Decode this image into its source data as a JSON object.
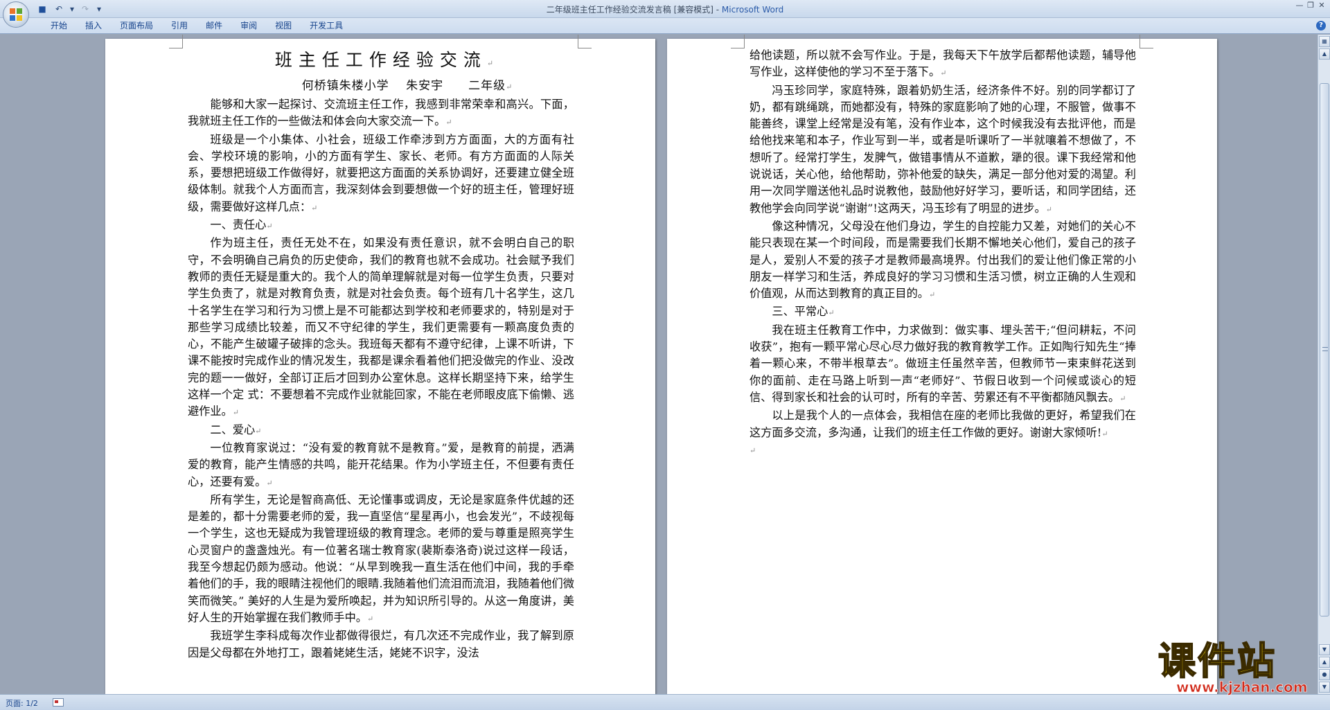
{
  "window": {
    "title": "二年级班主任工作经验交流发言稿 [兼容模式] - ",
    "app_name": "Microsoft Word"
  },
  "ribbon": {
    "tabs": [
      "开始",
      "插入",
      "页面布局",
      "引用",
      "邮件",
      "审阅",
      "视图",
      "开发工具"
    ]
  },
  "status": {
    "page": "页面: 1/2"
  },
  "watermark": {
    "text": "课件站",
    "url": "www.kjzhan.com"
  },
  "page1": {
    "title": "班主任工作经验交流",
    "subtitle": "何桥镇朱楼小学　 朱安宇　　二年级",
    "paragraphs": [
      "能够和大家一起探讨、交流班主任工作，我感到非常荣幸和高兴。下面，我就班主任工作的一些做法和体会向大家交流一下。",
      "班级是一个小集体、小社会，班级工作牵涉到方方面面，大的方面有社会、学校环境的影响，小的方面有学生、家长、老师。有方方面面的人际关系，要想把班级工作做得好，就要把这方面面的关系协调好，还要建立健全班级体制。就我个人方面而言，我深刻体会到要想做一个好的班主任，管理好班级，需要做好这样几点：",
      "一、责任心",
      "作为班主任，责任无处不在，如果没有责任意识，就不会明白自己的职守，不会明确自己肩负的历史使命，我们的教育也就不会成功。社会赋予我们教师的责任无疑是重大的。我个人的简单理解就是对每一位学生负责，只要对学生负责了，就是对教育负责，就是对社会负责。每个班有几十名学生，这几十名学生在学习和行为习惯上是不可能都达到学校和老师要求的，特别是对于那些学习成绩比较差，而又不守纪律的学生，我们更需要有一颗高度负责的心，不能产生破罐子破摔的念头。我班每天都有不遵守纪律，上课不听讲，下课不能按时完成作业的情况发生，我都是课余看着他们把没做完的作业、没改完的题一一做好，全部订正后才回到办公室休息。这样长期坚持下来，给学生这样一个定 式：不要想着不完成作业就能回家，不能在老师眼皮底下偷懒、逃避作业。",
      "二、爱心",
      "一位教育家说过：“没有爱的教育就不是教育。”爱，是教育的前提，洒满爱的教育，能产生情感的共鸣，能开花结果。作为小学班主任，不但要有责任心，还要有爱。",
      "所有学生，无论是智商高低、无论懂事或调皮，无论是家庭条件优越的还是差的，都十分需要老师的爱，我一直坚信“星星再小，也会发光”，不歧视每一个学生，这也无疑成为我管理班级的教育理念。老师的爱与尊重是照亮学生心灵窗户的盏盏烛光。有一位著名瑞士教育家(裴斯泰洛奇)说过这样一段话，我至今想起仍颇为感动。他说：“从早到晚我一直生活在他们中间，我的手牵着他们的手，我的眼睛注视他们的眼睛.我随着他们流泪而流泪，我随着他们微笑而微笑。” 美好的人生是为爱所唤起，并为知识所引导的。从这一角度讲，美好人生的开始掌握在我们教师手中。",
      "我班学生李科成每次作业都做得很烂，有几次还不完成作业，我了解到原因是父母都在外地打工，跟着姥姥生活，姥姥不识字，没法"
    ]
  },
  "page2": {
    "paragraphs": [
      "给他读题，所以就不会写作业。于是，我每天下午放学后都帮他读题，辅导他写作业，这样使他的学习不至于落下。",
      "冯玉珍同学，家庭特殊，跟着奶奶生活，经济条件不好。别的同学都订了奶，都有跳绳跳，而她都没有，特殊的家庭影响了她的心理，不服管，做事不能善终，课堂上经常是没有笔，没有作业本，这个时候我没有去批评他，而是给他找来笔和本子，作业写到一半，或者是听课听了一半就嚷着不想做了，不想听了。经常打学生，发脾气，做错事情从不道歉，犟的很。课下我经常和他说说话，关心他，给他帮助，弥补他爱的缺失，满足一部分他对爱的渴望。利用一次同学赠送他礼品时说教他，鼓励他好好学习，要听话，和同学团结，还教他学会向同学说“谢谢”!这两天，冯玉珍有了明显的进步。",
      "像这种情况，父母没在他们身边，学生的自控能力又差，对她们的关心不能只表现在某一个时间段，而是需要我们长期不懈地关心他们，爱自己的孩子是人，爱别人不爱的孩子才是教师最高境界。付出我们的爱让他们像正常的小朋友一样学习和生活，养成良好的学习习惯和生活习惯，树立正确的人生观和价值观，从而达到教育的真正目的。",
      "三、平常心",
      "我在班主任教育工作中，力求做到：做实事、埋头苦干;“但问耕耘，不问收获”，抱有一颗平常心尽心尽力做好我的教育教学工作。正如陶行知先生“捧着一颗心来，不带半根草去”。做班主任虽然辛苦，但教师节一束束鲜花送到你的面前、走在马路上听到一声“老师好”、节假日收到一个问候或谈心的短信、得到家长和社会的认可时，所有的辛苦、劳累还有不平衡都随风飘去。",
      "以上是我个人的一点体会，我相信在座的老师比我做的更好，希望我们在这方面多交流，多沟通，让我们的班主任工作做的更好。谢谢大家倾听!"
    ]
  }
}
